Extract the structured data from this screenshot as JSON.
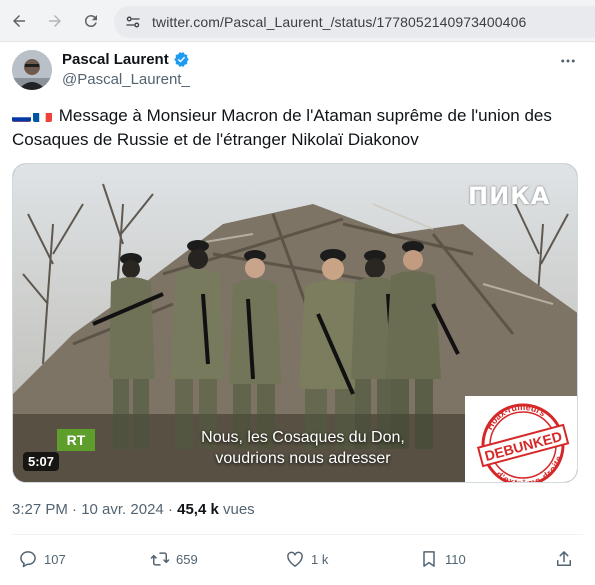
{
  "browser": {
    "url": "twitter.com/Pascal_Laurent_/status/1778052140973400406"
  },
  "tweet": {
    "author_name": "Pascal Laurent",
    "author_handle": "@Pascal_Laurent_",
    "text": "Message à Monsieur Macron de l'Ataman suprême de l'union des Cosaques de Russie et de l'étranger Nikolaï Diakonov",
    "flags": [
      "russia-flag",
      "france-flag"
    ],
    "timestamp": "3:27 PM · 10 avr. 2024",
    "separator": "·",
    "views_count": "45,4 k",
    "views_label": "vues"
  },
  "media": {
    "duration": "5:07",
    "subtitle_line1": "Nous, les Cosaques du Don,",
    "subtitle_line2": "voudrions nous adresser",
    "channel_logo": "RT",
    "watermark_logo": "ПИКА",
    "stamp": {
      "main": "DEBUNKED",
      "top": "Hoax-rumeurs",
      "bottom": "d'extrême-droite",
      "color": "#d62828"
    }
  },
  "actions": {
    "replies": "107",
    "retweets": "659",
    "likes": "1 k",
    "bookmarks": "110"
  },
  "colors": {
    "accent": "#1d9bf0",
    "secondary_text": "#536471",
    "primary_text": "#0f1419"
  }
}
